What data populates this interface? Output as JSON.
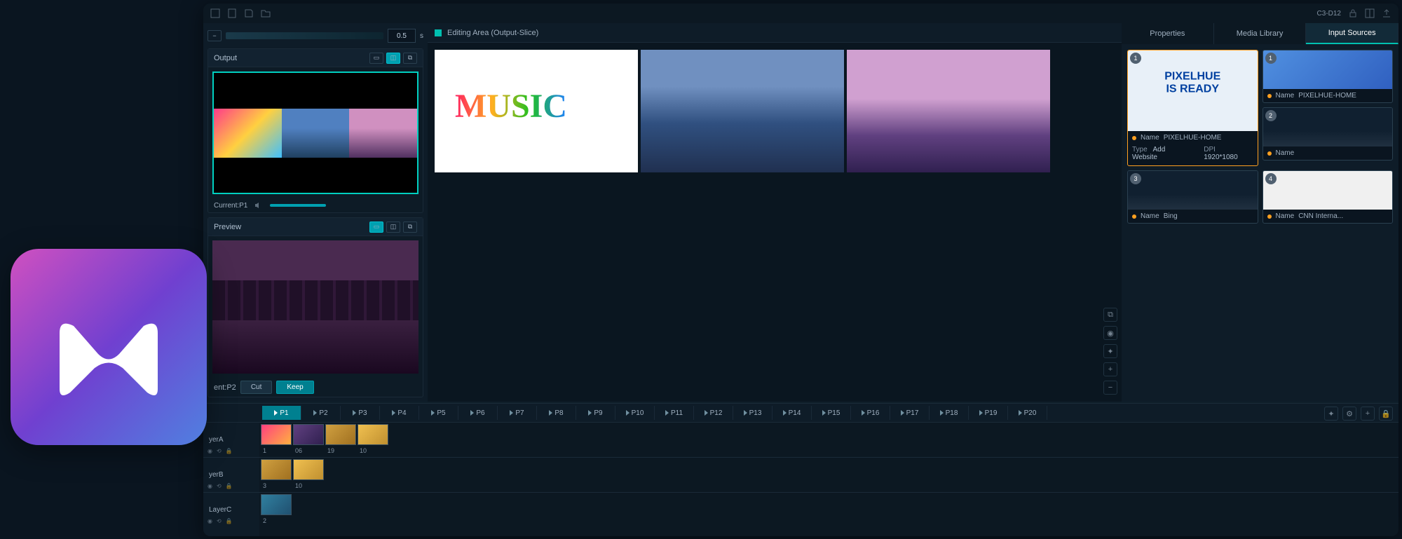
{
  "titlebar": {
    "device": "C3-D12"
  },
  "leftCol": {
    "transition": {
      "value": "0.5",
      "unit": "s"
    },
    "output": {
      "title": "Output",
      "current": "Current:P1"
    },
    "preview": {
      "title": "Preview",
      "current": "ent:P2",
      "cut": "Cut",
      "keep": "Keep"
    }
  },
  "editing": {
    "title": "Editing Area (Output-Slice)"
  },
  "rightCol": {
    "tabs": {
      "properties": "Properties",
      "media": "Media Library",
      "inputs": "Input Sources"
    },
    "sources": [
      {
        "badge": "1",
        "name_label": "Name",
        "name": "PIXELHUE-HOME",
        "type_label": "Type",
        "type": "Add Website",
        "dpi_label": "DPI",
        "dpi": "1920*1080"
      },
      {
        "badge": "1",
        "name_label": "Name",
        "name": "PIXELHUE-HOME"
      },
      {
        "badge": "2",
        "name_label": "Name",
        "name": ""
      },
      {
        "badge": "3",
        "name_label": "Name",
        "name": "Bing"
      },
      {
        "badge": "4",
        "name_label": "Name",
        "name": "CNN Interna..."
      }
    ],
    "ph_text": "PIXELHUE IS READY"
  },
  "timeline": {
    "programs": [
      "P1",
      "P2",
      "P3",
      "P4",
      "P5",
      "P6",
      "P7",
      "P8",
      "P9",
      "P10",
      "P11",
      "P12",
      "P13",
      "P14",
      "P15",
      "P16",
      "P17",
      "P18",
      "P19",
      "P20"
    ],
    "layers": [
      {
        "label": "yerA",
        "clips": [
          "1",
          "06",
          "19",
          "10"
        ]
      },
      {
        "label": "yerB",
        "clips": [
          "3",
          "10"
        ]
      },
      {
        "label": "LayerC",
        "clips": [
          "2"
        ]
      }
    ]
  }
}
